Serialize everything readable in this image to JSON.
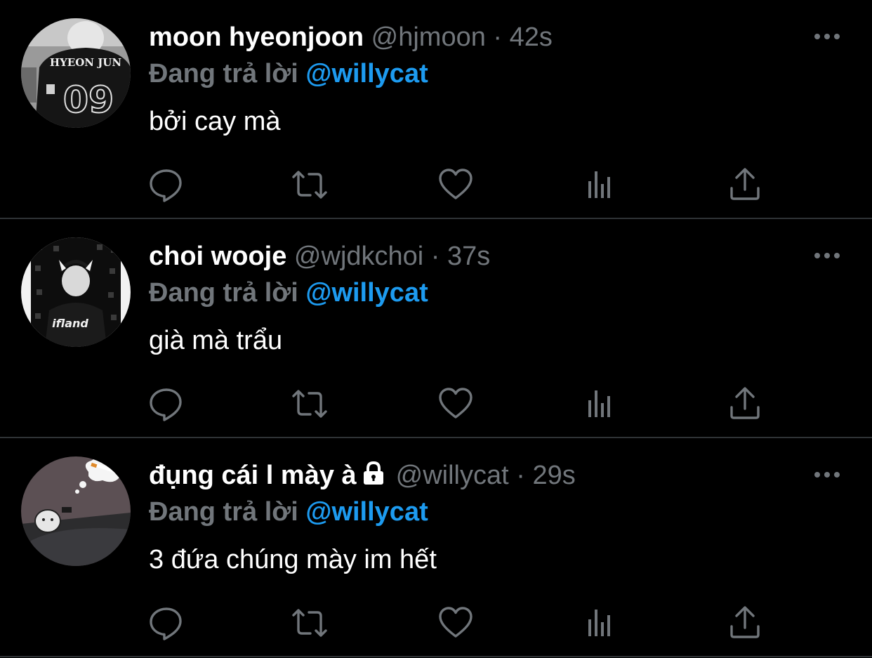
{
  "tweets": [
    {
      "display_name": "moon hyeonjoon",
      "handle": "@hjmoon",
      "separator": "·",
      "time": "42s",
      "reply_prefix": "Đang trả lời",
      "reply_to": "@willycat",
      "text": "bởi cay mà",
      "avatar_jersey_name": "HYEON JUN",
      "avatar_jersey_number": "09",
      "protected": false
    },
    {
      "display_name": "choi wooje",
      "handle": "@wjdkchoi",
      "separator": "·",
      "time": "37s",
      "reply_prefix": "Đang trả lời",
      "reply_to": "@willycat",
      "text": "già mà trẩu",
      "avatar_shirt_text": "ifland",
      "protected": false
    },
    {
      "display_name": "đụng cái l mày à",
      "handle": "@willycat",
      "separator": "·",
      "time": "29s",
      "reply_prefix": "Đang trả lời",
      "reply_to": "@willycat",
      "text": "3 đứa chúng mày im hết",
      "protected": true
    }
  ],
  "icons": {
    "more": "more-horizontal-icon",
    "reply": "reply-bubble-icon",
    "retweet": "retweet-icon",
    "like": "heart-icon",
    "views": "views-bar-chart-icon",
    "share": "share-upload-icon",
    "lock": "lock-icon"
  },
  "colors": {
    "background": "#000000",
    "text_primary": "#ffffff",
    "text_secondary": "#71767b",
    "accent": "#1d9bf0",
    "divider": "#2f3336"
  }
}
